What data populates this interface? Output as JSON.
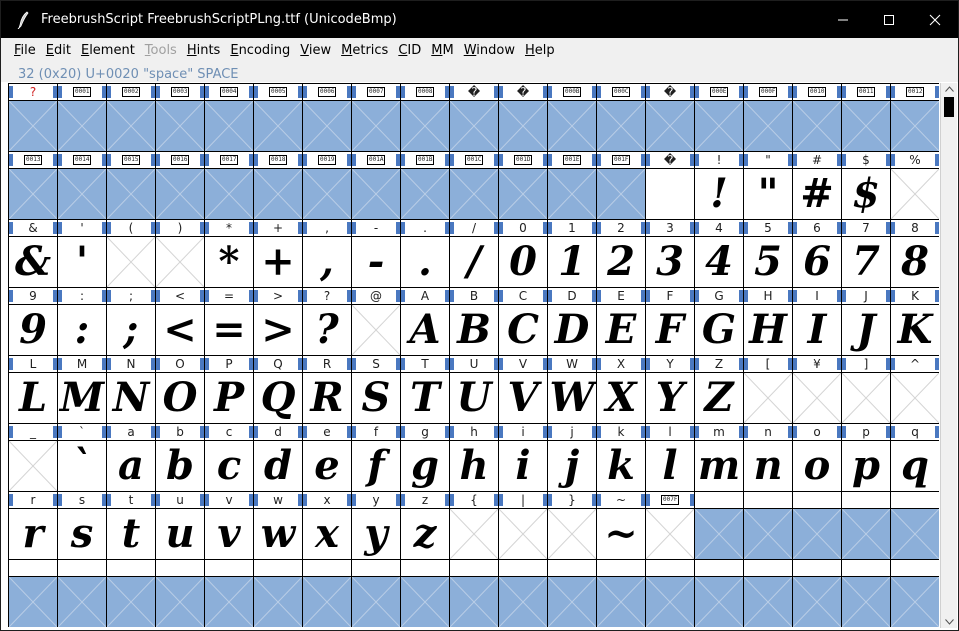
{
  "window": {
    "title": "FreebrushScript  FreebrushScriptPLng.ttf (UnicodeBmp)"
  },
  "icons": {
    "app": "quill-pen-icon",
    "minimize": "minimize-icon",
    "maximize": "maximize-icon",
    "close": "close-icon",
    "scroll_up": "scroll-up-arrow-icon",
    "scroll_down": "scroll-down-arrow-icon"
  },
  "menu": [
    {
      "label": "File",
      "u": "F",
      "rest": "ile",
      "disabled": false
    },
    {
      "label": "Edit",
      "u": "E",
      "rest": "dit",
      "disabled": false
    },
    {
      "label": "Element",
      "u": "E",
      "rest": "lement",
      "disabled": false
    },
    {
      "label": "Tools",
      "u": "T",
      "rest": "ools",
      "disabled": true
    },
    {
      "label": "Hints",
      "u": "H",
      "rest": "ints",
      "disabled": false
    },
    {
      "label": "Encoding",
      "u": "E",
      "rest": "ncoding",
      "disabled": false
    },
    {
      "label": "View",
      "u": "V",
      "rest": "iew",
      "disabled": false
    },
    {
      "label": "Metrics",
      "u": "M",
      "rest": "etrics",
      "disabled": false
    },
    {
      "label": "CID",
      "u": "C",
      "rest": "ID",
      "disabled": false
    },
    {
      "label": "MM",
      "u": "M",
      "rest": "M",
      "disabled": false
    },
    {
      "label": "Window",
      "u": "W",
      "rest": "indow",
      "disabled": false
    },
    {
      "label": "Help",
      "u": "H",
      "rest": "elp",
      "disabled": false
    }
  ],
  "info": {
    "selected_glyph": "32 (0x20) U+0020 \"space\" SPACE"
  },
  "colors": {
    "empty_slot_fill": "#8cafd9",
    "selection_marker": "#4a78c0",
    "info_text": "#6f8fb4",
    "missing_label": "#d02020"
  },
  "cells": [
    {
      "label": "?",
      "kind": "red",
      "glyph": "",
      "fill": "blue",
      "x": true
    },
    {
      "label": "0001",
      "kind": "hex",
      "glyph": "",
      "fill": "blue",
      "x": true
    },
    {
      "label": "0002",
      "kind": "hex",
      "glyph": "",
      "fill": "blue",
      "x": true
    },
    {
      "label": "0003",
      "kind": "hex",
      "glyph": "",
      "fill": "blue",
      "x": true
    },
    {
      "label": "0004",
      "kind": "hex",
      "glyph": "",
      "fill": "blue",
      "x": true
    },
    {
      "label": "0005",
      "kind": "hex",
      "glyph": "",
      "fill": "blue",
      "x": true
    },
    {
      "label": "0006",
      "kind": "hex",
      "glyph": "",
      "fill": "blue",
      "x": true
    },
    {
      "label": "0007",
      "kind": "hex",
      "glyph": "",
      "fill": "blue",
      "x": true
    },
    {
      "label": "0008",
      "kind": "hex",
      "glyph": "",
      "fill": "blue",
      "x": true
    },
    {
      "label": "�",
      "kind": "text",
      "glyph": "",
      "fill": "blue",
      "x": true
    },
    {
      "label": "�",
      "kind": "text",
      "glyph": "",
      "fill": "blue",
      "x": true
    },
    {
      "label": "000B",
      "kind": "hex",
      "glyph": "",
      "fill": "blue",
      "x": true
    },
    {
      "label": "000C",
      "kind": "hex",
      "glyph": "",
      "fill": "blue",
      "x": true
    },
    {
      "label": "�",
      "kind": "text",
      "glyph": "",
      "fill": "blue",
      "x": true
    },
    {
      "label": "000E",
      "kind": "hex",
      "glyph": "",
      "fill": "blue",
      "x": true
    },
    {
      "label": "000F",
      "kind": "hex",
      "glyph": "",
      "fill": "blue",
      "x": true
    },
    {
      "label": "0010",
      "kind": "hex",
      "glyph": "",
      "fill": "blue",
      "x": true
    },
    {
      "label": "0011",
      "kind": "hex",
      "glyph": "",
      "fill": "blue",
      "x": true
    },
    {
      "label": "0012",
      "kind": "hex",
      "glyph": "",
      "fill": "blue",
      "x": true
    },
    {
      "label": "0013",
      "kind": "hex",
      "glyph": "",
      "fill": "blue",
      "x": true
    },
    {
      "label": "0014",
      "kind": "hex",
      "glyph": "",
      "fill": "blue",
      "x": true
    },
    {
      "label": "0015",
      "kind": "hex",
      "glyph": "",
      "fill": "blue",
      "x": true
    },
    {
      "label": "0016",
      "kind": "hex",
      "glyph": "",
      "fill": "blue",
      "x": true
    },
    {
      "label": "0017",
      "kind": "hex",
      "glyph": "",
      "fill": "blue",
      "x": true
    },
    {
      "label": "0018",
      "kind": "hex",
      "glyph": "",
      "fill": "blue",
      "x": true
    },
    {
      "label": "0019",
      "kind": "hex",
      "glyph": "",
      "fill": "blue",
      "x": true
    },
    {
      "label": "001A",
      "kind": "hex",
      "glyph": "",
      "fill": "blue",
      "x": true
    },
    {
      "label": "001B",
      "kind": "hex",
      "glyph": "",
      "fill": "blue",
      "x": true
    },
    {
      "label": "001C",
      "kind": "hex",
      "glyph": "",
      "fill": "blue",
      "x": true
    },
    {
      "label": "001D",
      "kind": "hex",
      "glyph": "",
      "fill": "blue",
      "x": true
    },
    {
      "label": "001E",
      "kind": "hex",
      "glyph": "",
      "fill": "blue",
      "x": true
    },
    {
      "label": "001F",
      "kind": "hex",
      "glyph": "",
      "fill": "blue",
      "x": true
    },
    {
      "label": "�",
      "kind": "text",
      "glyph": "",
      "fill": "white",
      "x": false,
      "selected": true
    },
    {
      "label": "!",
      "kind": "text",
      "glyph": "!",
      "fill": "white",
      "x": false
    },
    {
      "label": "\"",
      "kind": "text",
      "glyph": "\"",
      "fill": "white",
      "x": false
    },
    {
      "label": "#",
      "kind": "text",
      "glyph": "#",
      "fill": "white",
      "x": false
    },
    {
      "label": "$",
      "kind": "text",
      "glyph": "$",
      "fill": "white",
      "x": false
    },
    {
      "label": "%",
      "kind": "text",
      "glyph": "",
      "fill": "white",
      "x": true
    },
    {
      "label": "&",
      "kind": "text",
      "glyph": "&",
      "fill": "white",
      "x": false
    },
    {
      "label": "'",
      "kind": "text",
      "glyph": "'",
      "fill": "white",
      "x": false
    },
    {
      "label": "(",
      "kind": "text",
      "glyph": "",
      "fill": "white",
      "x": true
    },
    {
      "label": ")",
      "kind": "text",
      "glyph": "",
      "fill": "white",
      "x": true
    },
    {
      "label": "*",
      "kind": "text",
      "glyph": "*",
      "fill": "white",
      "x": false
    },
    {
      "label": "+",
      "kind": "text",
      "glyph": "+",
      "fill": "white",
      "x": false
    },
    {
      "label": ",",
      "kind": "text",
      "glyph": ",",
      "fill": "white",
      "x": false
    },
    {
      "label": "-",
      "kind": "text",
      "glyph": "-",
      "fill": "white",
      "x": false
    },
    {
      "label": ".",
      "kind": "text",
      "glyph": ".",
      "fill": "white",
      "x": false
    },
    {
      "label": "/",
      "kind": "text",
      "glyph": "/",
      "fill": "white",
      "x": false
    },
    {
      "label": "0",
      "kind": "text",
      "glyph": "0",
      "fill": "white",
      "x": false
    },
    {
      "label": "1",
      "kind": "text",
      "glyph": "1",
      "fill": "white",
      "x": false
    },
    {
      "label": "2",
      "kind": "text",
      "glyph": "2",
      "fill": "white",
      "x": false
    },
    {
      "label": "3",
      "kind": "text",
      "glyph": "3",
      "fill": "white",
      "x": false
    },
    {
      "label": "4",
      "kind": "text",
      "glyph": "4",
      "fill": "white",
      "x": false
    },
    {
      "label": "5",
      "kind": "text",
      "glyph": "5",
      "fill": "white",
      "x": false
    },
    {
      "label": "6",
      "kind": "text",
      "glyph": "6",
      "fill": "white",
      "x": false
    },
    {
      "label": "7",
      "kind": "text",
      "glyph": "7",
      "fill": "white",
      "x": false
    },
    {
      "label": "8",
      "kind": "text",
      "glyph": "8",
      "fill": "white",
      "x": false
    },
    {
      "label": "9",
      "kind": "text",
      "glyph": "9",
      "fill": "white",
      "x": false
    },
    {
      "label": ":",
      "kind": "text",
      "glyph": ":",
      "fill": "white",
      "x": false
    },
    {
      "label": ";",
      "kind": "text",
      "glyph": ";",
      "fill": "white",
      "x": false
    },
    {
      "label": "<",
      "kind": "text",
      "glyph": "<",
      "fill": "white",
      "x": false
    },
    {
      "label": "=",
      "kind": "text",
      "glyph": "=",
      "fill": "white",
      "x": false
    },
    {
      "label": ">",
      "kind": "text",
      "glyph": ">",
      "fill": "white",
      "x": false
    },
    {
      "label": "?",
      "kind": "text",
      "glyph": "?",
      "fill": "white",
      "x": false
    },
    {
      "label": "@",
      "kind": "text",
      "glyph": "",
      "fill": "white",
      "x": true
    },
    {
      "label": "A",
      "kind": "text",
      "glyph": "A",
      "fill": "white",
      "x": false
    },
    {
      "label": "B",
      "kind": "text",
      "glyph": "B",
      "fill": "white",
      "x": false
    },
    {
      "label": "C",
      "kind": "text",
      "glyph": "C",
      "fill": "white",
      "x": false
    },
    {
      "label": "D",
      "kind": "text",
      "glyph": "D",
      "fill": "white",
      "x": false
    },
    {
      "label": "E",
      "kind": "text",
      "glyph": "E",
      "fill": "white",
      "x": false
    },
    {
      "label": "F",
      "kind": "text",
      "glyph": "F",
      "fill": "white",
      "x": false
    },
    {
      "label": "G",
      "kind": "text",
      "glyph": "G",
      "fill": "white",
      "x": false
    },
    {
      "label": "H",
      "kind": "text",
      "glyph": "H",
      "fill": "white",
      "x": false
    },
    {
      "label": "I",
      "kind": "text",
      "glyph": "I",
      "fill": "white",
      "x": false
    },
    {
      "label": "J",
      "kind": "text",
      "glyph": "J",
      "fill": "white",
      "x": false
    },
    {
      "label": "K",
      "kind": "text",
      "glyph": "K",
      "fill": "white",
      "x": false
    },
    {
      "label": "L",
      "kind": "text",
      "glyph": "L",
      "fill": "white",
      "x": false
    },
    {
      "label": "M",
      "kind": "text",
      "glyph": "M",
      "fill": "white",
      "x": false
    },
    {
      "label": "N",
      "kind": "text",
      "glyph": "N",
      "fill": "white",
      "x": false
    },
    {
      "label": "O",
      "kind": "text",
      "glyph": "O",
      "fill": "white",
      "x": false
    },
    {
      "label": "P",
      "kind": "text",
      "glyph": "P",
      "fill": "white",
      "x": false
    },
    {
      "label": "Q",
      "kind": "text",
      "glyph": "Q",
      "fill": "white",
      "x": false
    },
    {
      "label": "R",
      "kind": "text",
      "glyph": "R",
      "fill": "white",
      "x": false
    },
    {
      "label": "S",
      "kind": "text",
      "glyph": "S",
      "fill": "white",
      "x": false
    },
    {
      "label": "T",
      "kind": "text",
      "glyph": "T",
      "fill": "white",
      "x": false
    },
    {
      "label": "U",
      "kind": "text",
      "glyph": "U",
      "fill": "white",
      "x": false
    },
    {
      "label": "V",
      "kind": "text",
      "glyph": "V",
      "fill": "white",
      "x": false
    },
    {
      "label": "W",
      "kind": "text",
      "glyph": "W",
      "fill": "white",
      "x": false
    },
    {
      "label": "X",
      "kind": "text",
      "glyph": "X",
      "fill": "white",
      "x": false
    },
    {
      "label": "Y",
      "kind": "text",
      "glyph": "Y",
      "fill": "white",
      "x": false
    },
    {
      "label": "Z",
      "kind": "text",
      "glyph": "Z",
      "fill": "white",
      "x": false
    },
    {
      "label": "[",
      "kind": "text",
      "glyph": "",
      "fill": "white",
      "x": true
    },
    {
      "label": "¥",
      "kind": "text",
      "glyph": "",
      "fill": "white",
      "x": true
    },
    {
      "label": "]",
      "kind": "text",
      "glyph": "",
      "fill": "white",
      "x": true
    },
    {
      "label": "^",
      "kind": "text",
      "glyph": "",
      "fill": "white",
      "x": true
    },
    {
      "label": "_",
      "kind": "text",
      "glyph": "",
      "fill": "white",
      "x": true
    },
    {
      "label": "`",
      "kind": "text",
      "glyph": "`",
      "fill": "white",
      "x": false
    },
    {
      "label": "a",
      "kind": "text",
      "glyph": "a",
      "fill": "white",
      "x": false
    },
    {
      "label": "b",
      "kind": "text",
      "glyph": "b",
      "fill": "white",
      "x": false
    },
    {
      "label": "c",
      "kind": "text",
      "glyph": "c",
      "fill": "white",
      "x": false
    },
    {
      "label": "d",
      "kind": "text",
      "glyph": "d",
      "fill": "white",
      "x": false
    },
    {
      "label": "e",
      "kind": "text",
      "glyph": "e",
      "fill": "white",
      "x": false
    },
    {
      "label": "f",
      "kind": "text",
      "glyph": "f",
      "fill": "white",
      "x": false
    },
    {
      "label": "g",
      "kind": "text",
      "glyph": "g",
      "fill": "white",
      "x": false
    },
    {
      "label": "h",
      "kind": "text",
      "glyph": "h",
      "fill": "white",
      "x": false
    },
    {
      "label": "i",
      "kind": "text",
      "glyph": "i",
      "fill": "white",
      "x": false
    },
    {
      "label": "j",
      "kind": "text",
      "glyph": "j",
      "fill": "white",
      "x": false
    },
    {
      "label": "k",
      "kind": "text",
      "glyph": "k",
      "fill": "white",
      "x": false
    },
    {
      "label": "l",
      "kind": "text",
      "glyph": "l",
      "fill": "white",
      "x": false
    },
    {
      "label": "m",
      "kind": "text",
      "glyph": "m",
      "fill": "white",
      "x": false
    },
    {
      "label": "n",
      "kind": "text",
      "glyph": "n",
      "fill": "white",
      "x": false
    },
    {
      "label": "o",
      "kind": "text",
      "glyph": "o",
      "fill": "white",
      "x": false
    },
    {
      "label": "p",
      "kind": "text",
      "glyph": "p",
      "fill": "white",
      "x": false
    },
    {
      "label": "q",
      "kind": "text",
      "glyph": "q",
      "fill": "white",
      "x": false
    },
    {
      "label": "r",
      "kind": "text",
      "glyph": "r",
      "fill": "white",
      "x": false
    },
    {
      "label": "s",
      "kind": "text",
      "glyph": "s",
      "fill": "white",
      "x": false
    },
    {
      "label": "t",
      "kind": "text",
      "glyph": "t",
      "fill": "white",
      "x": false
    },
    {
      "label": "u",
      "kind": "text",
      "glyph": "u",
      "fill": "white",
      "x": false
    },
    {
      "label": "v",
      "kind": "text",
      "glyph": "v",
      "fill": "white",
      "x": false
    },
    {
      "label": "w",
      "kind": "text",
      "glyph": "w",
      "fill": "white",
      "x": false
    },
    {
      "label": "x",
      "kind": "text",
      "glyph": "x",
      "fill": "white",
      "x": false
    },
    {
      "label": "y",
      "kind": "text",
      "glyph": "y",
      "fill": "white",
      "x": false
    },
    {
      "label": "z",
      "kind": "text",
      "glyph": "z",
      "fill": "white",
      "x": false
    },
    {
      "label": "{",
      "kind": "text",
      "glyph": "",
      "fill": "white",
      "x": true
    },
    {
      "label": "|",
      "kind": "text",
      "glyph": "",
      "fill": "white",
      "x": true
    },
    {
      "label": "}",
      "kind": "text",
      "glyph": "",
      "fill": "white",
      "x": true
    },
    {
      "label": "~",
      "kind": "text",
      "glyph": "~",
      "fill": "white",
      "x": false
    },
    {
      "label": "007F",
      "kind": "hex",
      "glyph": "",
      "fill": "white",
      "x": true
    },
    {
      "label": "",
      "kind": "text",
      "glyph": "",
      "fill": "blue",
      "x": true
    },
    {
      "label": "",
      "kind": "text",
      "glyph": "",
      "fill": "blue",
      "x": true
    },
    {
      "label": "",
      "kind": "text",
      "glyph": "",
      "fill": "blue",
      "x": true
    },
    {
      "label": "",
      "kind": "text",
      "glyph": "",
      "fill": "blue",
      "x": true
    },
    {
      "label": "",
      "kind": "text",
      "glyph": "",
      "fill": "blue",
      "x": true
    },
    {
      "label": "",
      "kind": "text",
      "glyph": "",
      "fill": "blue",
      "x": true
    },
    {
      "label": "",
      "kind": "text",
      "glyph": "",
      "fill": "blue",
      "x": true
    },
    {
      "label": "",
      "kind": "text",
      "glyph": "",
      "fill": "blue",
      "x": true
    },
    {
      "label": "",
      "kind": "text",
      "glyph": "",
      "fill": "blue",
      "x": true
    },
    {
      "label": "",
      "kind": "text",
      "glyph": "",
      "fill": "blue",
      "x": true
    },
    {
      "label": "",
      "kind": "text",
      "glyph": "",
      "fill": "blue",
      "x": true
    },
    {
      "label": "",
      "kind": "text",
      "glyph": "",
      "fill": "blue",
      "x": true
    },
    {
      "label": "",
      "kind": "text",
      "glyph": "",
      "fill": "blue",
      "x": true
    },
    {
      "label": "",
      "kind": "text",
      "glyph": "",
      "fill": "blue",
      "x": true
    },
    {
      "label": "",
      "kind": "text",
      "glyph": "",
      "fill": "blue",
      "x": true
    },
    {
      "label": "",
      "kind": "text",
      "glyph": "",
      "fill": "blue",
      "x": true
    },
    {
      "label": "",
      "kind": "text",
      "glyph": "",
      "fill": "blue",
      "x": true
    },
    {
      "label": "",
      "kind": "text",
      "glyph": "",
      "fill": "blue",
      "x": true
    },
    {
      "label": "",
      "kind": "text",
      "glyph": "",
      "fill": "blue",
      "x": true
    },
    {
      "label": "",
      "kind": "text",
      "glyph": "",
      "fill": "blue",
      "x": true
    },
    {
      "label": "",
      "kind": "text",
      "glyph": "",
      "fill": "blue",
      "x": true
    },
    {
      "label": "",
      "kind": "text",
      "glyph": "",
      "fill": "blue",
      "x": true
    },
    {
      "label": "",
      "kind": "text",
      "glyph": "",
      "fill": "blue",
      "x": true
    },
    {
      "label": "",
      "kind": "text",
      "glyph": "",
      "fill": "blue",
      "x": true
    }
  ]
}
